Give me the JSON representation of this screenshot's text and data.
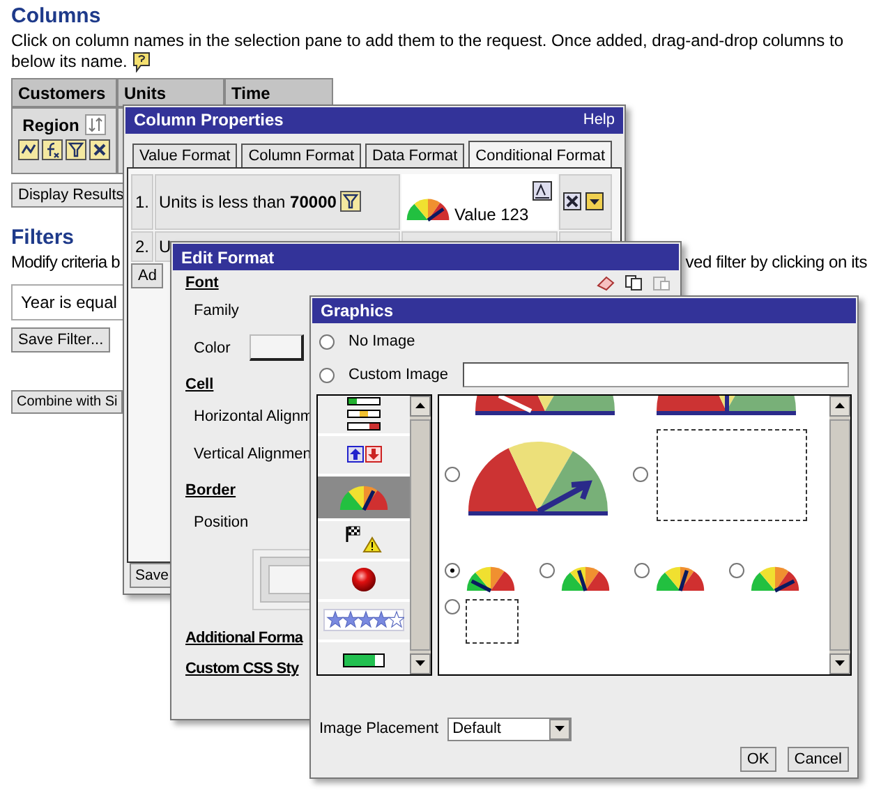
{
  "columns_section": {
    "heading": "Columns",
    "description_line_1": "Click on column names in the selection pane to add them to the request. Once added, drag-and-drop columns to",
    "description_line_2": "below its name.",
    "table": {
      "headers": [
        "Customers",
        "Units",
        "Time"
      ],
      "column_label": "Region"
    },
    "display_button": "Display Results"
  },
  "filters": {
    "heading": "Filters",
    "description_start": "Modify criteria b",
    "description_end": "ved filter by clicking on its",
    "filter_text": "Year is equal",
    "save_button": "Save Filter...",
    "combine_button": "Combine with Si"
  },
  "column_properties": {
    "title": "Column Properties",
    "help": "Help",
    "tabs": [
      {
        "label": "Value Format",
        "selected": false
      },
      {
        "label": "Column Format",
        "selected": false
      },
      {
        "label": "Data Format",
        "selected": false
      },
      {
        "label": "Conditional Format",
        "selected": true
      }
    ],
    "conditions": [
      {
        "number": "1.",
        "text": "Units is less than **70000**",
        "preview": "Value 123"
      },
      {
        "number": "2.",
        "text": "U"
      }
    ],
    "add_button": "Ad",
    "save_button": "Save"
  },
  "edit_format": {
    "title": "Edit Format",
    "sections": [
      {
        "heading": "Font",
        "rows": [
          {
            "label": "Family",
            "kind": "text"
          },
          {
            "label": "Color",
            "kind": "color"
          }
        ]
      },
      {
        "heading": "Cell",
        "rows": [
          {
            "label": "Horizontal Alignm",
            "kind": "text"
          },
          {
            "label": "Vertical Alignmen",
            "kind": "text"
          }
        ]
      },
      {
        "heading": "Border",
        "rows": [
          {
            "label": "Position",
            "kind": "border"
          }
        ]
      }
    ],
    "links": [
      "Additional Forma",
      "Custom CSS Sty"
    ]
  },
  "graphics": {
    "title": "Graphics",
    "image_options": [
      {
        "label": "No Image",
        "selected": false
      },
      {
        "label": "Custom Image",
        "selected": false,
        "kind": "custom"
      }
    ],
    "categories": [
      {
        "kind": "bars",
        "selected": false
      },
      {
        "kind": "arrows",
        "selected": false
      },
      {
        "kind": "gauge",
        "selected": true
      },
      {
        "kind": "flags",
        "selected": false
      },
      {
        "kind": "ball",
        "selected": false
      },
      {
        "kind": "stars",
        "selected": false
      },
      {
        "kind": "progress",
        "selected": false
      }
    ],
    "images": [
      {
        "kind": "large_gauge",
        "selected": false
      },
      {
        "kind": "large_empty",
        "selected": false
      },
      {
        "kind": "gauge_left",
        "selected": true
      },
      {
        "kind": "gauge_up_left",
        "selected": false
      },
      {
        "kind": "gauge_up_right",
        "selected": false
      },
      {
        "kind": "gauge_right",
        "selected": false
      },
      {
        "kind": "empty",
        "selected": false
      }
    ],
    "placement_label": "Image Placement",
    "placement_value": "Default",
    "ok_button": "OK",
    "cancel_button": "Cancel"
  }
}
